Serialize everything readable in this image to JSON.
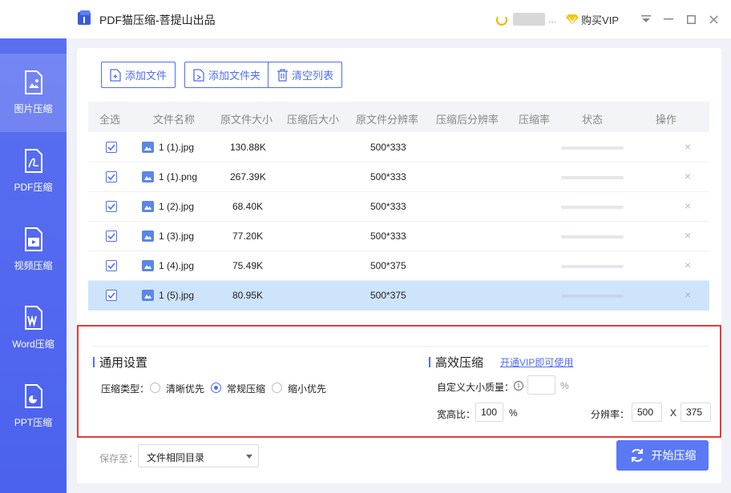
{
  "titlebar": {
    "app_title": "PDF猫压缩-菩提山出品",
    "user_dots": "...",
    "vip_label": "购买VIP",
    "window_controls": {
      "menu": "⏷",
      "minimize": "–",
      "maximize": "☐",
      "close": "✕"
    }
  },
  "sidebar": {
    "items": [
      {
        "label": "图片压缩",
        "icon": "image-file-icon",
        "active": true
      },
      {
        "label": "PDF压缩",
        "icon": "pdf-file-icon",
        "active": false
      },
      {
        "label": "视频压缩",
        "icon": "video-file-icon",
        "active": false
      },
      {
        "label": "Word压缩",
        "icon": "word-file-icon",
        "active": false
      },
      {
        "label": "PPT压缩",
        "icon": "ppt-file-icon",
        "active": false
      }
    ]
  },
  "toolbar": {
    "add_file": "添加文件",
    "add_folder": "添加文件夹",
    "clear_list": "清空列表"
  },
  "table": {
    "headers": {
      "select_all": "全选",
      "file_name": "文件名称",
      "orig_size": "原文件大小",
      "comp_size": "压缩后大小",
      "orig_res": "原文件分辨率",
      "comp_res": "压缩后分辨率",
      "ratio": "压缩率",
      "status": "状态",
      "action": "操作"
    },
    "rows": [
      {
        "name": "1 (1).jpg",
        "size": "130.88K",
        "resolution": "500*333",
        "checked": true,
        "selected": false,
        "delete": "×"
      },
      {
        "name": "1 (1).png",
        "size": "267.39K",
        "resolution": "500*333",
        "checked": true,
        "selected": false,
        "delete": "×"
      },
      {
        "name": "1 (2).jpg",
        "size": "68.40K",
        "resolution": "500*333",
        "checked": true,
        "selected": false,
        "delete": "×"
      },
      {
        "name": "1 (3).jpg",
        "size": "77.20K",
        "resolution": "500*333",
        "checked": true,
        "selected": false,
        "delete": "×"
      },
      {
        "name": "1 (4).jpg",
        "size": "75.49K",
        "resolution": "500*375",
        "checked": true,
        "selected": false,
        "delete": "×"
      },
      {
        "name": "1 (5).jpg",
        "size": "80.95K",
        "resolution": "500*375",
        "checked": true,
        "selected": true,
        "delete": "×"
      }
    ]
  },
  "settings": {
    "general_title": "通用设置",
    "compress_type_label": "压缩类型：",
    "options": [
      {
        "label": "清晰优先",
        "selected": false
      },
      {
        "label": "常规压缩",
        "selected": true
      },
      {
        "label": "缩小优先",
        "selected": false
      }
    ],
    "efficient_title": "高效压缩",
    "vip_link": "开通VIP即可使用",
    "custom_quality_label": "自定义大小质量：",
    "info_glyph": "i",
    "custom_quality_value": "",
    "percent_unit": "%",
    "aspect_label": "宽高比：",
    "aspect_value": "100",
    "aspect_unit": "%",
    "resolution_label": "分辨率：",
    "res_width": "500",
    "res_separator": "X",
    "res_height": "375"
  },
  "bottom": {
    "save_label": "保存至：",
    "save_value": "文件相同目录",
    "start_button": "开始压缩"
  },
  "colors": {
    "accent": "#4f6ef2",
    "sidebar": "#5065ef",
    "selected_row": "#cde4fb",
    "highlight_border": "#e73a3a"
  }
}
